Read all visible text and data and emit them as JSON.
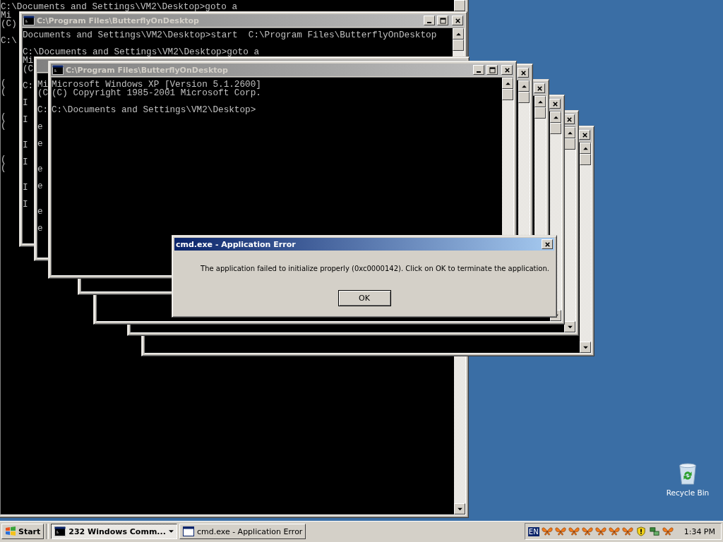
{
  "console_windows": [
    {
      "kind": "console",
      "lines": [
        "C:\\Documents and Settings\\VM2\\Desktop>goto a",
        "Mi",
        "(C)",
        "C:\\",
        "(",
        "(",
        "(",
        "(",
        "(",
        "("
      ]
    },
    {
      "kind": "console"
    },
    {
      "kind": "console"
    },
    {
      "kind": "console"
    },
    {
      "kind": "console"
    },
    {
      "kind": "console"
    },
    {
      "kind": "console",
      "title": "C:\\Program Files\\ButterflyOnDesktop",
      "lines": [
        "Documents and Settings\\VM2\\Desktop>start  C:\\Program Files\\ButterflyOnDesktop",
        "C:\\Documents and Settings\\VM2\\Desktop>goto a",
        "Mi",
        "(C",
        "C:",
        "I",
        "I",
        "I",
        "I",
        "I",
        "I"
      ]
    },
    {
      "kind": "console",
      "lines": [
        "Mi",
        "(C",
        "C:",
        "e",
        "e",
        "e",
        "e",
        "e",
        "e"
      ]
    },
    {
      "kind": "console",
      "title": "C:\\Program Files\\ButterflyOnDesktop",
      "lines": [
        "Microsoft Windows XP [Version 5.1.2600]",
        "(C) Copyright 1985-2001 Microsoft Corp.",
        "C:\\Documents and Settings\\VM2\\Desktop>"
      ]
    }
  ],
  "error_dialog": {
    "title": "cmd.exe - Application Error",
    "message": "The application failed to initialize properly (0xc0000142). Click on OK to terminate the application.",
    "button": "OK"
  },
  "desktop_icons": [
    {
      "label": "Recycle Bin"
    }
  ],
  "taskbar": {
    "start": "Start",
    "tasks": [
      {
        "label": "232 Windows Comm...",
        "kind": "group",
        "selected": true
      },
      {
        "label": "cmd.exe - Application Error",
        "kind": "window",
        "selected": false
      }
    ],
    "language": "EN",
    "clock": "1:34 PM"
  }
}
